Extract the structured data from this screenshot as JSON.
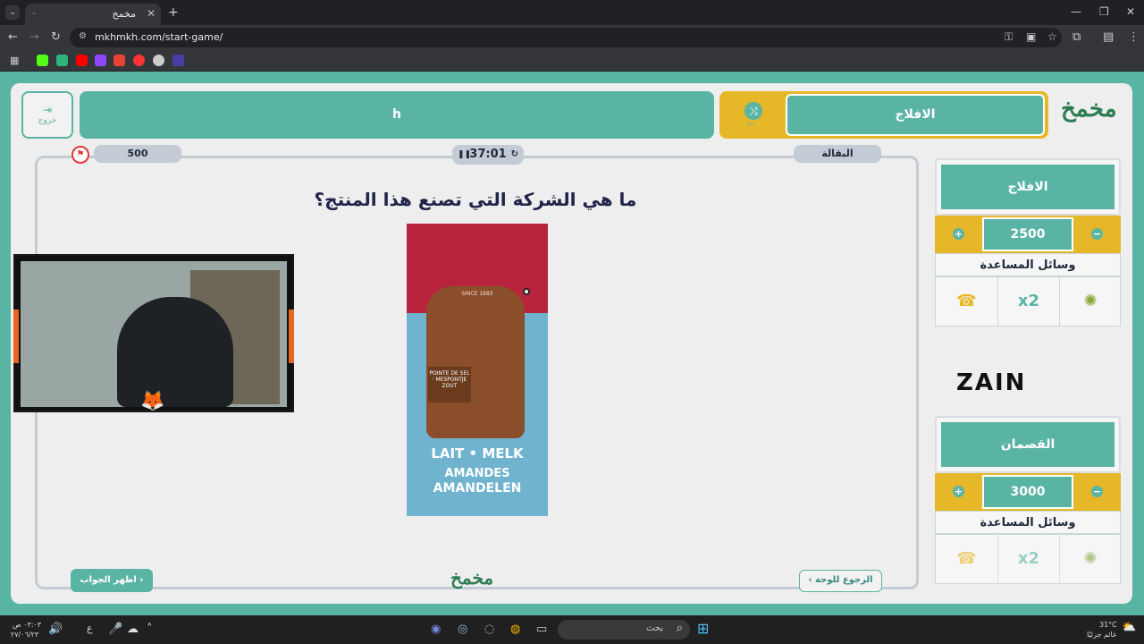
{
  "browser": {
    "tab_title": "مخمخ",
    "url": "mkhmkh.com/start-game/"
  },
  "header": {
    "exit_label": "خروج",
    "team_bar_text": "h",
    "current_team": "الافلاج",
    "swap_label": "بدل"
  },
  "board": {
    "points": "500",
    "timer": "37:01",
    "category": "البقالة",
    "question": "ما هي الشركة التي تصنع هذا المنتج؟",
    "show_answer": "اظهر الجواب",
    "back_to_board": "الرجوع للوحة"
  },
  "product": {
    "since": "SINCE 1883",
    "pointe": "POINTE DE SEL · MESPONTJE ZOUT",
    "lait": "LAIT • MELK",
    "am1": "AMANDES",
    "am2": "AMANDELEN"
  },
  "teams": [
    {
      "name": "الافلاج",
      "score": "2500",
      "aids_title": "وسائل المساعدة"
    },
    {
      "name": "القصمان",
      "score": "3000",
      "aids_title": "وسائل المساعدة"
    }
  ],
  "sponsor": "ZAIN",
  "logo_text": "مخمخ",
  "taskbar": {
    "search_label": "بحث",
    "time": "٠٣:٠٣ ص",
    "date": "٢٧/٠٦/٢٣",
    "weather_temp": "31°C",
    "weather_desc": "غائم جزئيًا",
    "lang": "ع"
  }
}
